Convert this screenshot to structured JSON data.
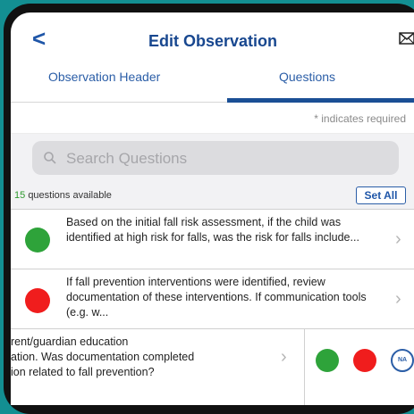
{
  "header": {
    "back_glyph": "<",
    "title": "Edit Observation",
    "mail_icon": "mail-icon"
  },
  "tabs": [
    {
      "label": "Observation Header",
      "selected": false
    },
    {
      "label": "Questions",
      "selected": true
    }
  ],
  "required_note": "* indicates required",
  "search": {
    "placeholder": "Search Questions"
  },
  "questions_count": {
    "number": "15",
    "label": "questions available"
  },
  "set_all_label": "Set All",
  "questions": [
    {
      "text": "Based on the initial fall risk assessment, if the child was identified at high risk for falls, was the risk for falls include...",
      "status_color": "#2ea33a"
    },
    {
      "text": "If fall prevention interventions were identified, review documentation of these interventions. If communication tools (e.g. w...",
      "status_color": "#f01d1d"
    },
    {
      "text": "rent/guardian education ation. Was documentation completed ion related to fall prevention?",
      "line1": "rent/guardian education",
      "line2": "ation. Was documentation completed",
      "line3": "ion related to fall prevention?",
      "na_label": "NA"
    }
  ],
  "colors": {
    "accent": "#1f56a8",
    "green": "#2ea33a",
    "red": "#f01d1d",
    "background": "#138f92"
  }
}
